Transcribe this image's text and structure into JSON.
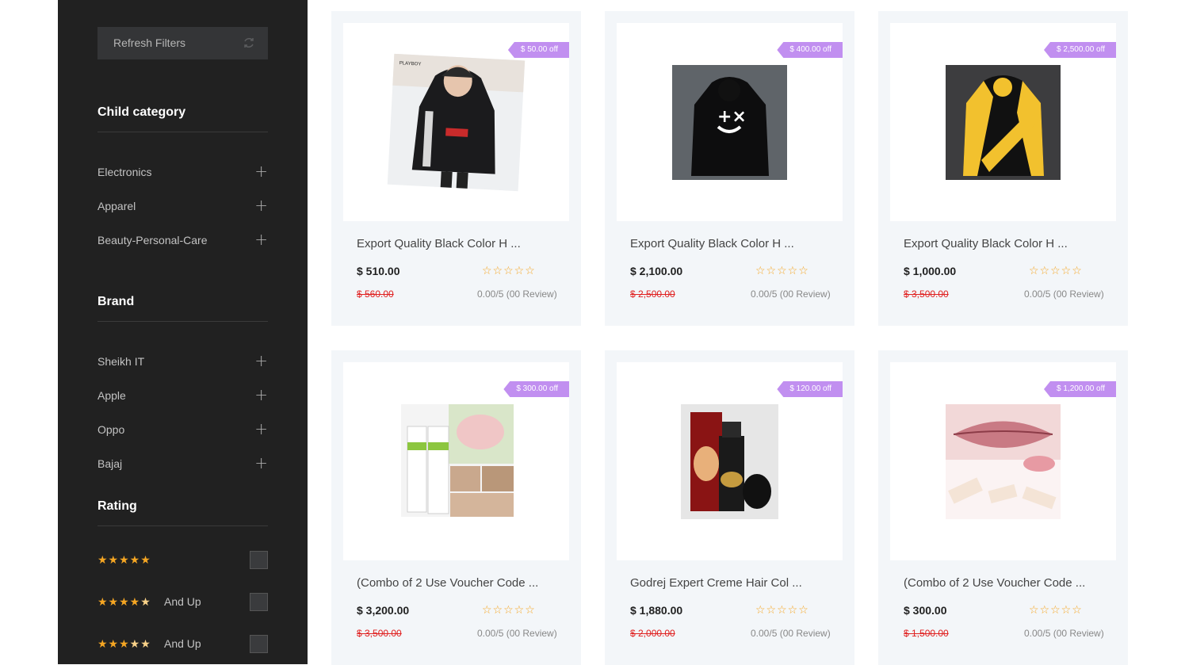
{
  "sidebar": {
    "refresh_label": "Refresh Filters",
    "child_category": {
      "title": "Child category",
      "items": [
        "Electronics",
        "Apparel",
        "Beauty-Personal-Care"
      ]
    },
    "brand": {
      "title": "Brand",
      "items": [
        "Sheikh IT",
        "Apple",
        "Oppo",
        "Bajaj"
      ]
    },
    "rating": {
      "title": "Rating",
      "rows": [
        {
          "stars": 5,
          "suffix": ""
        },
        {
          "stars": 4,
          "suffix": "And Up"
        },
        {
          "stars": 3,
          "suffix": "And Up"
        }
      ]
    }
  },
  "products": [
    {
      "name": "Export Quality Black Color H ...",
      "discount": "$ 50.00 off",
      "price": "$ 510.00",
      "old_price": "$ 560.00",
      "rating_text": "0.00/5 (00 Review)",
      "image": "black-hoodie-stripes"
    },
    {
      "name": "Export Quality Black Color H ...",
      "discount": "$ 400.00 off",
      "price": "$ 2,100.00",
      "old_price": "$ 2,500.00",
      "rating_text": "0.00/5 (00 Review)",
      "image": "black-hoodie-smiley"
    },
    {
      "name": "Export Quality Black Color H ...",
      "discount": "$ 2,500.00 off",
      "price": "$ 1,000.00",
      "old_price": "$ 3,500.00",
      "rating_text": "0.00/5 (00 Review)",
      "image": "yellow-black-hoodie"
    },
    {
      "name": "(Combo of 2 Use Voucher Code ...",
      "discount": "$ 300.00 off",
      "price": "$ 3,200.00",
      "old_price": "$ 3,500.00",
      "rating_text": "0.00/5 (00 Review)",
      "image": "nail-cream-combo"
    },
    {
      "name": "Godrej Expert Creme Hair Col ...",
      "discount": "$ 120.00 off",
      "price": "$ 1,880.00",
      "old_price": "$ 2,000.00",
      "rating_text": "0.00/5 (00 Review)",
      "image": "spray-bottle"
    },
    {
      "name": "(Combo of 2 Use Voucher Code ...",
      "discount": "$ 1,200.00 off",
      "price": "$ 300.00",
      "old_price": "$ 1,500.00",
      "rating_text": "0.00/5 (00 Review)",
      "image": "lip-scrub"
    }
  ],
  "colors": {
    "sidebar_bg": "#212121",
    "badge": "#c18ff0",
    "star": "#f5a623",
    "old_price": "#e02020",
    "card_bg": "#f3f6f9"
  }
}
